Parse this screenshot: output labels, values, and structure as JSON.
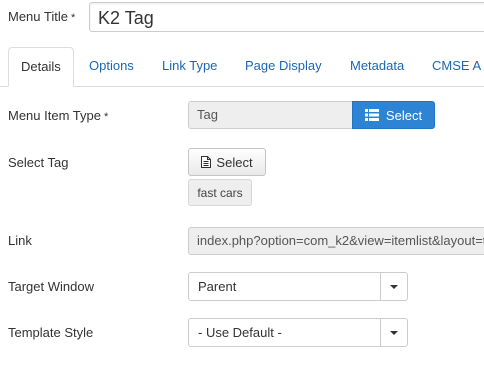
{
  "menu_title": {
    "label": "Menu Title",
    "required_mark": "*",
    "value": "K2 Tag"
  },
  "tabs": [
    {
      "label": "Details",
      "active": true
    },
    {
      "label": "Options",
      "active": false
    },
    {
      "label": "Link Type",
      "active": false
    },
    {
      "label": "Page Display",
      "active": false
    },
    {
      "label": "Metadata",
      "active": false
    },
    {
      "label": "CMSE A",
      "active": false
    }
  ],
  "menu_item_type": {
    "label": "Menu Item Type",
    "required_mark": "*",
    "value": "Tag",
    "button_label": "Select",
    "button_icon": "list-icon"
  },
  "select_tag": {
    "label": "Select Tag",
    "button_label": "Select",
    "button_icon": "file-icon",
    "selected_tag": "fast cars"
  },
  "link": {
    "label": "Link",
    "value": "index.php?option=com_k2&view=itemlist&layout=t"
  },
  "target_window": {
    "label": "Target Window",
    "value": "Parent"
  },
  "template_style": {
    "label": "Template Style",
    "value": "- Use Default -"
  },
  "colors": {
    "primary_button": "#2d83d4",
    "tab_link": "#1c66b3"
  }
}
